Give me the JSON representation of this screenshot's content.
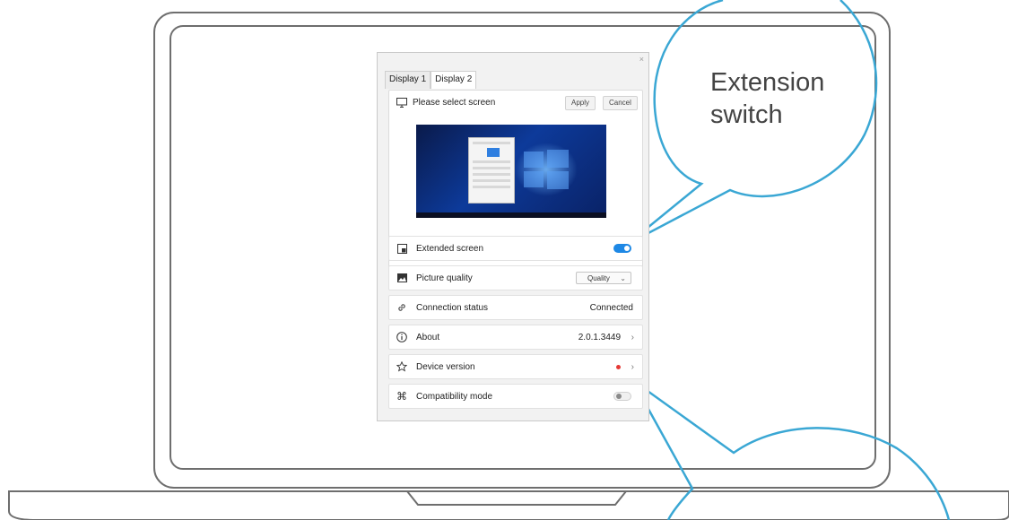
{
  "callout": {
    "label_line1": "Extension",
    "label_line2": "switch"
  },
  "window": {
    "close_glyph": "×",
    "tabs": [
      {
        "label": "Display 1"
      },
      {
        "label": "Display 2"
      }
    ],
    "screen_panel": {
      "title": "Please select screen",
      "apply_label": "Apply",
      "cancel_label": "Cancel"
    },
    "rows": {
      "extended_screen": {
        "label": "Extended screen",
        "toggle_on": true
      },
      "picture_quality": {
        "label": "Picture quality",
        "selected": "Quality"
      },
      "connection_status": {
        "label": "Connection status",
        "value": "Connected"
      },
      "about": {
        "label": "About",
        "value": "2.0.1.3449"
      },
      "device_version": {
        "label": "Device version",
        "badge_color": "#e53935"
      },
      "compatibility_mode": {
        "label": "Compatibility mode",
        "toggle_on": false
      }
    },
    "accent_color": "#1e88e5",
    "callout_color": "#3aa7d4"
  }
}
